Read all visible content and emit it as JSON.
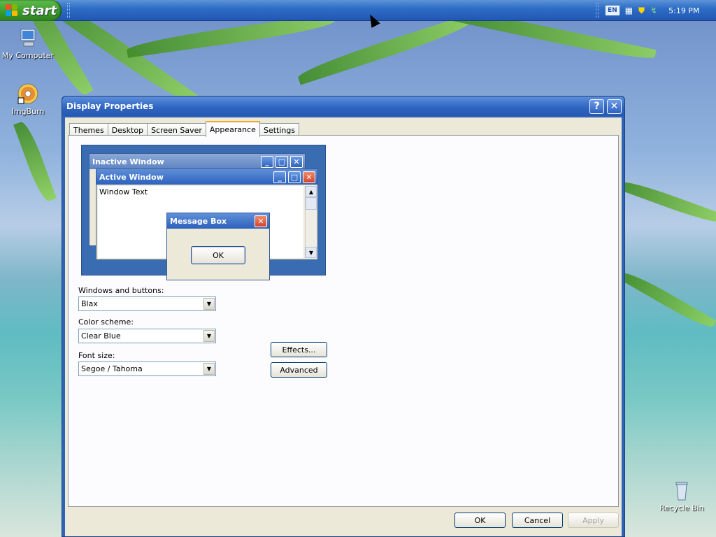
{
  "taskbar": {
    "start_label": "start",
    "language": "EN",
    "clock": "5:19 PM"
  },
  "desktop": {
    "icons": [
      {
        "label": "My Computer",
        "icon": "computer-icon"
      },
      {
        "label": "ImgBurn",
        "icon": "disc-icon"
      },
      {
        "label": "Recycle Bin",
        "icon": "recycle-bin-icon"
      }
    ]
  },
  "dialog": {
    "title": "Display Properties",
    "help_label": "?",
    "close_label": "✕",
    "tabs": [
      {
        "label": "Themes",
        "active": false
      },
      {
        "label": "Desktop",
        "active": false
      },
      {
        "label": "Screen Saver",
        "active": false
      },
      {
        "label": "Appearance",
        "active": true
      },
      {
        "label": "Settings",
        "active": false
      }
    ],
    "preview": {
      "inactive_title": "Inactive Window",
      "active_title": "Active Window",
      "window_text": "Window Text",
      "msgbox_title": "Message Box",
      "msgbox_ok": "OK"
    },
    "fields": {
      "windows_buttons_label": "Windows and buttons:",
      "windows_buttons_value": "Blax",
      "color_scheme_label": "Color scheme:",
      "color_scheme_value": "Clear Blue",
      "font_size_label": "Font size:",
      "font_size_value": "Segoe / Tahoma"
    },
    "effects_label": "Effects...",
    "advanced_label": "Advanced",
    "ok_label": "OK",
    "cancel_label": "Cancel",
    "apply_label": "Apply"
  },
  "colors": {
    "taskbar": "#2459b8",
    "start": "#3a9b2b",
    "titlebar": "#2f66c2",
    "dialog_face": "#ece9d8",
    "tab_active_accent": "#f3a737"
  }
}
